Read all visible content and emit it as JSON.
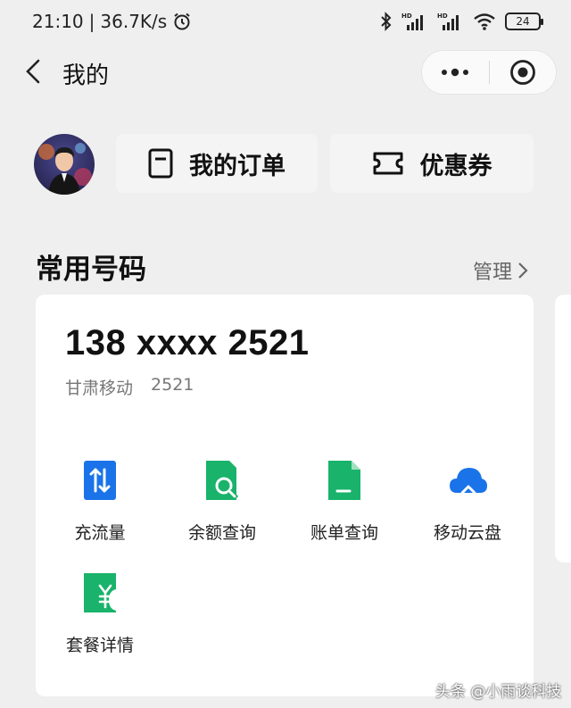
{
  "status_bar": {
    "time": "21:10",
    "separator": "|",
    "network_speed": "36.7K/s",
    "battery": "24",
    "icons": [
      "alarm-icon",
      "bluetooth-icon",
      "signal-hd-icon",
      "signal-hd-icon",
      "wifi-icon",
      "battery-icon"
    ]
  },
  "header": {
    "title": "我的",
    "back_icon": "chevron-left-icon",
    "more_icon": "more-dots-icon",
    "close_icon": "target-icon"
  },
  "profile": {
    "avatar_icon": "avatar",
    "orders_label": "我的订单",
    "orders_icon": "document-icon",
    "coupons_label": "优惠券",
    "coupons_icon": "ticket-icon"
  },
  "section": {
    "title": "常用号码",
    "manage_label": "管理",
    "manage_icon": "chevron-right-icon"
  },
  "number_card": {
    "phone": "138 xxxx 2521",
    "carrier": "甘肃移动",
    "short_number": "2521",
    "services": [
      {
        "label": "充流量",
        "icon": "data-transfer-icon",
        "color": "#1a73e8"
      },
      {
        "label": "余额查询",
        "icon": "balance-search-icon",
        "color": "#19b36b"
      },
      {
        "label": "账单查询",
        "icon": "bill-icon",
        "color": "#19b36b"
      },
      {
        "label": "移动云盘",
        "icon": "cloud-icon",
        "color": "#1a73e8"
      },
      {
        "label": "套餐详情",
        "icon": "plan-yuan-icon",
        "color": "#19b36b"
      }
    ]
  },
  "watermark": "头条 @小雨谈科技",
  "colors": {
    "background": "#efefef",
    "card": "#ffffff",
    "blue": "#1a73e8",
    "green": "#19b36b"
  }
}
